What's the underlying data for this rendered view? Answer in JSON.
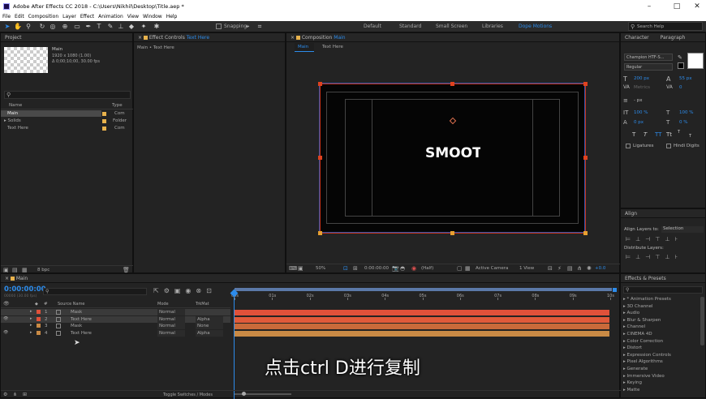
{
  "app": {
    "title": "Adobe After Effects CC 2018 - C:\\Users\\Nikhil\\Desktop\\Title.aep *"
  },
  "menu": [
    "File",
    "Edit",
    "Composition",
    "Layer",
    "Effect",
    "Animation",
    "View",
    "Window",
    "Help"
  ],
  "toolbar": {
    "snapping": "Snapping",
    "workspaces": [
      "Default",
      "Standard",
      "Small Screen",
      "Libraries",
      "Dope Motions"
    ],
    "search": "Search Help"
  },
  "project": {
    "header": "Project",
    "comp_name": "Main",
    "comp_meta1": "1920 x 1080 (1.00)",
    "comp_meta2": "Δ 0;00;10;00, 30.00 fps",
    "col_name": "Name",
    "col_type": "Type",
    "items": [
      {
        "name": "Main",
        "type": "Com"
      },
      {
        "name": "Solids",
        "type": "Folder"
      },
      {
        "name": "Text Here",
        "type": "Com"
      }
    ],
    "bpc": "8 bpc"
  },
  "effects_controls": {
    "header": "Effect Controls",
    "header_layer": "Text Here",
    "sub": "Main • Text Here"
  },
  "composition": {
    "header": "Composition",
    "header_name": "Main",
    "tab_main": "Main",
    "tab_text": "Text Here",
    "canvas_text": "SMOOTH",
    "zoom": "50%",
    "time": "0:00:00:00",
    "res": "(Half)",
    "camera": "Active Camera",
    "view": "1 View",
    "exposure": "+0.0"
  },
  "character": {
    "tab1": "Character",
    "tab2": "Paragraph",
    "font": "Champion HTF-S...",
    "style": "Regular",
    "size": "200 px",
    "leading": "55 px",
    "tracking_label": "Metrics",
    "tracking": "0",
    "stroke": "- px",
    "vscale": "100 %",
    "hscale": "100 %",
    "baseline": "0 px",
    "tsume": "0 %",
    "ligatures": "Ligatures",
    "hindi": "Hindi Digits",
    "styles": [
      "T",
      "T",
      "TT",
      "Tt",
      "T",
      "T"
    ]
  },
  "align": {
    "header": "Align",
    "align_to_label": "Align Layers to:",
    "align_to": "Selection",
    "distribute": "Distribute Layers:"
  },
  "effects_presets": {
    "header": "Effects & Presets",
    "search": "ρ•",
    "items": [
      "* Animation Presets",
      "3D Channel",
      "Audio",
      "Blur & Sharpen",
      "Channel",
      "CINEMA 4D",
      "Color Correction",
      "Distort",
      "Expression Controls",
      "Pixel Algorithms",
      "Generate",
      "Immersive Video",
      "Keying",
      "Matte"
    ]
  },
  "timeline": {
    "tab": "Main",
    "timecode": "0:00:00:00",
    "fps_info": "00000 (30.00 fps)",
    "col_num": "#",
    "col_source": "Source Name",
    "col_mode": "Mode",
    "col_trkmat": "TrkMat",
    "ticks": [
      "00s",
      "01s",
      "02s",
      "03s",
      "04s",
      "05s",
      "06s",
      "07s",
      "08s",
      "09s",
      "10s"
    ],
    "layers": [
      {
        "num": "1",
        "name": "Mask",
        "mode": "Normal",
        "trk": "",
        "color": "#e0513a",
        "bar": "#e0513a"
      },
      {
        "num": "2",
        "name": "Text Here",
        "mode": "Normal",
        "trk": "Alpha",
        "color": "#e0513a",
        "bar": "#e05a3a"
      },
      {
        "num": "3",
        "name": "Mask",
        "mode": "Normal",
        "trk": "None",
        "color": "#c98a45",
        "bar": "#c96a3a"
      },
      {
        "num": "4",
        "name": "Text Here",
        "mode": "Normal",
        "trk": "Alpha",
        "color": "#c98a45",
        "bar": "#c98a45"
      }
    ],
    "toggle": "Toggle Switches / Modes"
  },
  "subtitle": "点击ctrl D进行复制"
}
